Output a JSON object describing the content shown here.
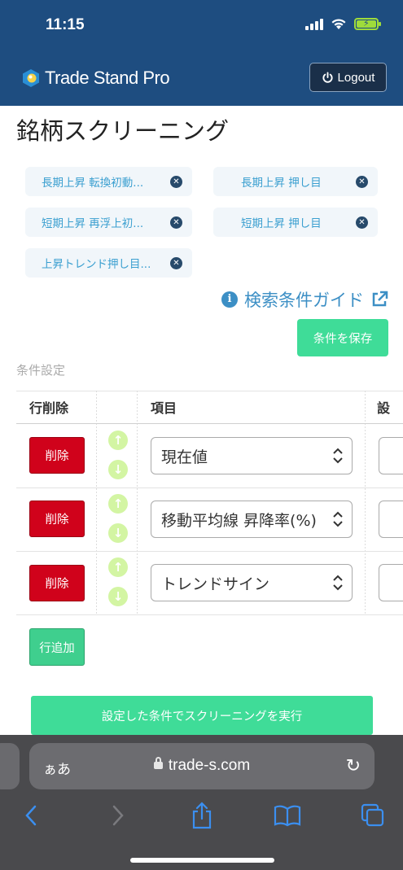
{
  "status_bar": {
    "time": "11:15"
  },
  "header": {
    "logo_text": "Trade Stand Pro",
    "logout_label": "Logout"
  },
  "page": {
    "title": "銘柄スクリーニング"
  },
  "tags": [
    {
      "label": "長期上昇 転換初動..."
    },
    {
      "label": "長期上昇 押し目"
    },
    {
      "label": "短期上昇 再浮上初..."
    },
    {
      "label": "短期上昇 押し目"
    },
    {
      "label": "上昇トレンド押し目..."
    }
  ],
  "guide": {
    "label": "検索条件ガイド"
  },
  "save_button": {
    "label": "条件を保存"
  },
  "conditions": {
    "section_label": "条件設定",
    "columns": {
      "delete": "行削除",
      "item": "項目",
      "cut": "設"
    },
    "rows": [
      {
        "delete_label": "削除",
        "item_value": "現在値"
      },
      {
        "delete_label": "削除",
        "item_value": "移動平均線 昇降率(%)"
      },
      {
        "delete_label": "削除",
        "item_value": "トレンドサイン"
      }
    ],
    "add_row_label": "行追加"
  },
  "run_button": {
    "label": "設定した条件でスクリーニングを実行"
  },
  "browser": {
    "aa_label": "ぁあ",
    "url": "trade-s.com"
  },
  "colors": {
    "header": "#1e4d80",
    "accent_green": "#3fdc98",
    "danger": "#d0021b",
    "link": "#3c8fc5"
  }
}
